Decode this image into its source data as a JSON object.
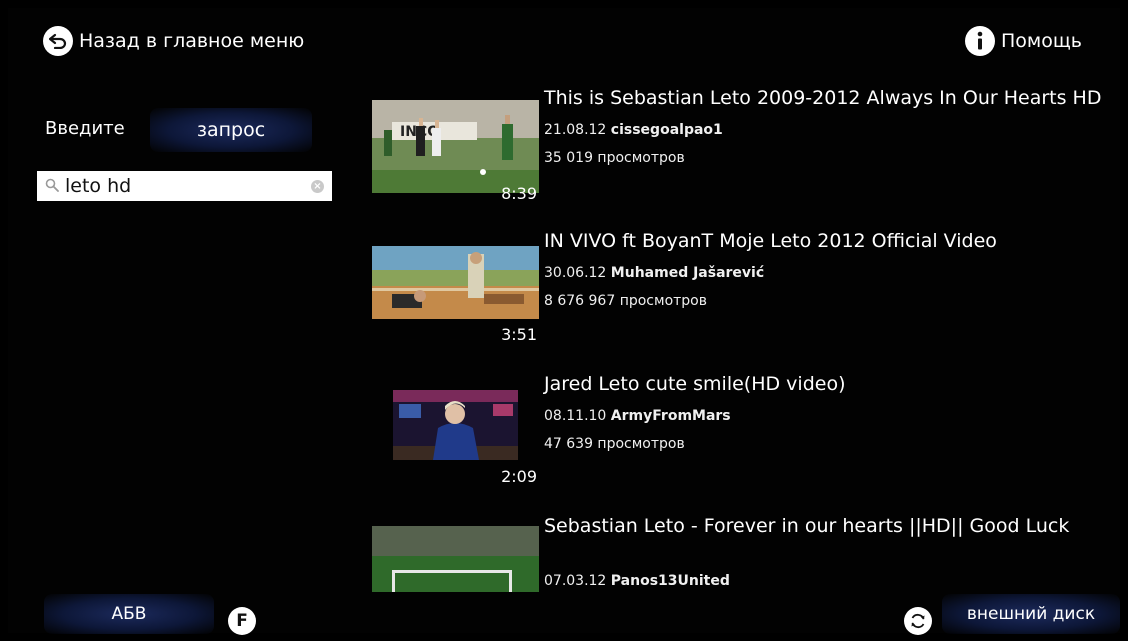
{
  "header": {
    "back_label": "Назад в главное меню",
    "back_icon": "back-arrow-icon",
    "help_label": "Помощь",
    "help_icon": "info-icon"
  },
  "search": {
    "prompt_label": "Введите",
    "query_button": "запрос",
    "value": "leto hd"
  },
  "results": [
    {
      "title": "This is Sebastian Leto 2009-2012 Always In Our Hearts HD",
      "date": "21.08.12",
      "author": "cissegoalpao1",
      "views": "35 019 просмотров",
      "duration": "8:39"
    },
    {
      "title": "IN VIVO ft  BoyanT   Moje Leto 2012 Official Video",
      "date": "30.06.12",
      "author": "Muhamed Jašarević",
      "views": "8 676 967 просмотров",
      "duration": "3:51"
    },
    {
      "title": "Jared Leto cute smile(HD video)",
      "date": "08.11.10",
      "author": "ArmyFromMars",
      "views": "47 639 просмотров",
      "duration": "2:09"
    },
    {
      "title": "Sebastian Leto - Forever in our hearts ||HD||  Good Luck",
      "date": "07.03.12",
      "author": "Panos13United",
      "views": "",
      "duration": ""
    }
  ],
  "footer": {
    "keyboard_label": "АБВ",
    "f_key_label": "F",
    "external_disk_label": "внешний диск",
    "refresh_icon": "refresh-icon"
  }
}
